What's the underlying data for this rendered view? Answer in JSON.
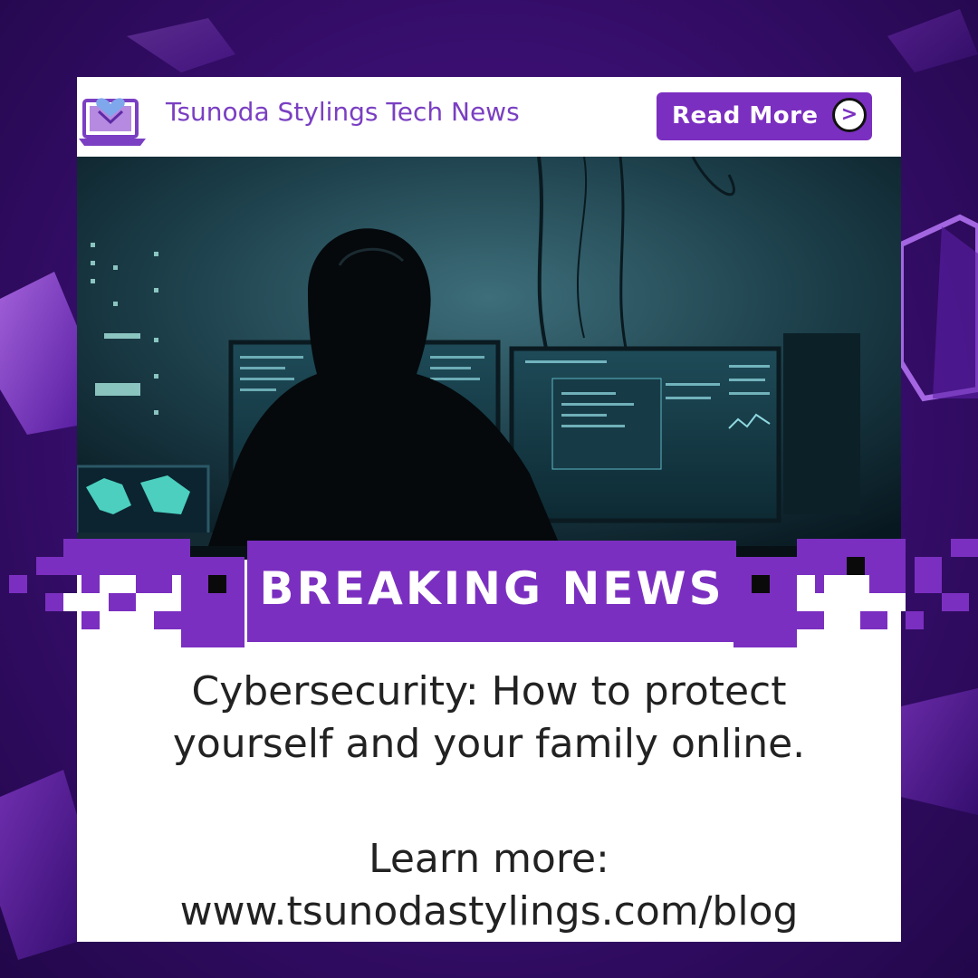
{
  "brand": {
    "name": "Tsunoda Stylings Tech News"
  },
  "cta": {
    "label": "Read More",
    "arrow": ">"
  },
  "banner": {
    "label": "BREAKING NEWS"
  },
  "headline": {
    "line1": "Cybersecurity: How to protect",
    "line2": "yourself and your family online."
  },
  "learn_more": {
    "label": "Learn more:",
    "url": "www.tsunodastylings.com/blog"
  },
  "colors": {
    "accent": "#7b2fc0",
    "background": "#3b0f73",
    "text": "#222222",
    "card": "#ffffff"
  },
  "icons": {
    "logo": "laptop-heart-icon",
    "cta_arrow": "chevron-right-icon"
  }
}
